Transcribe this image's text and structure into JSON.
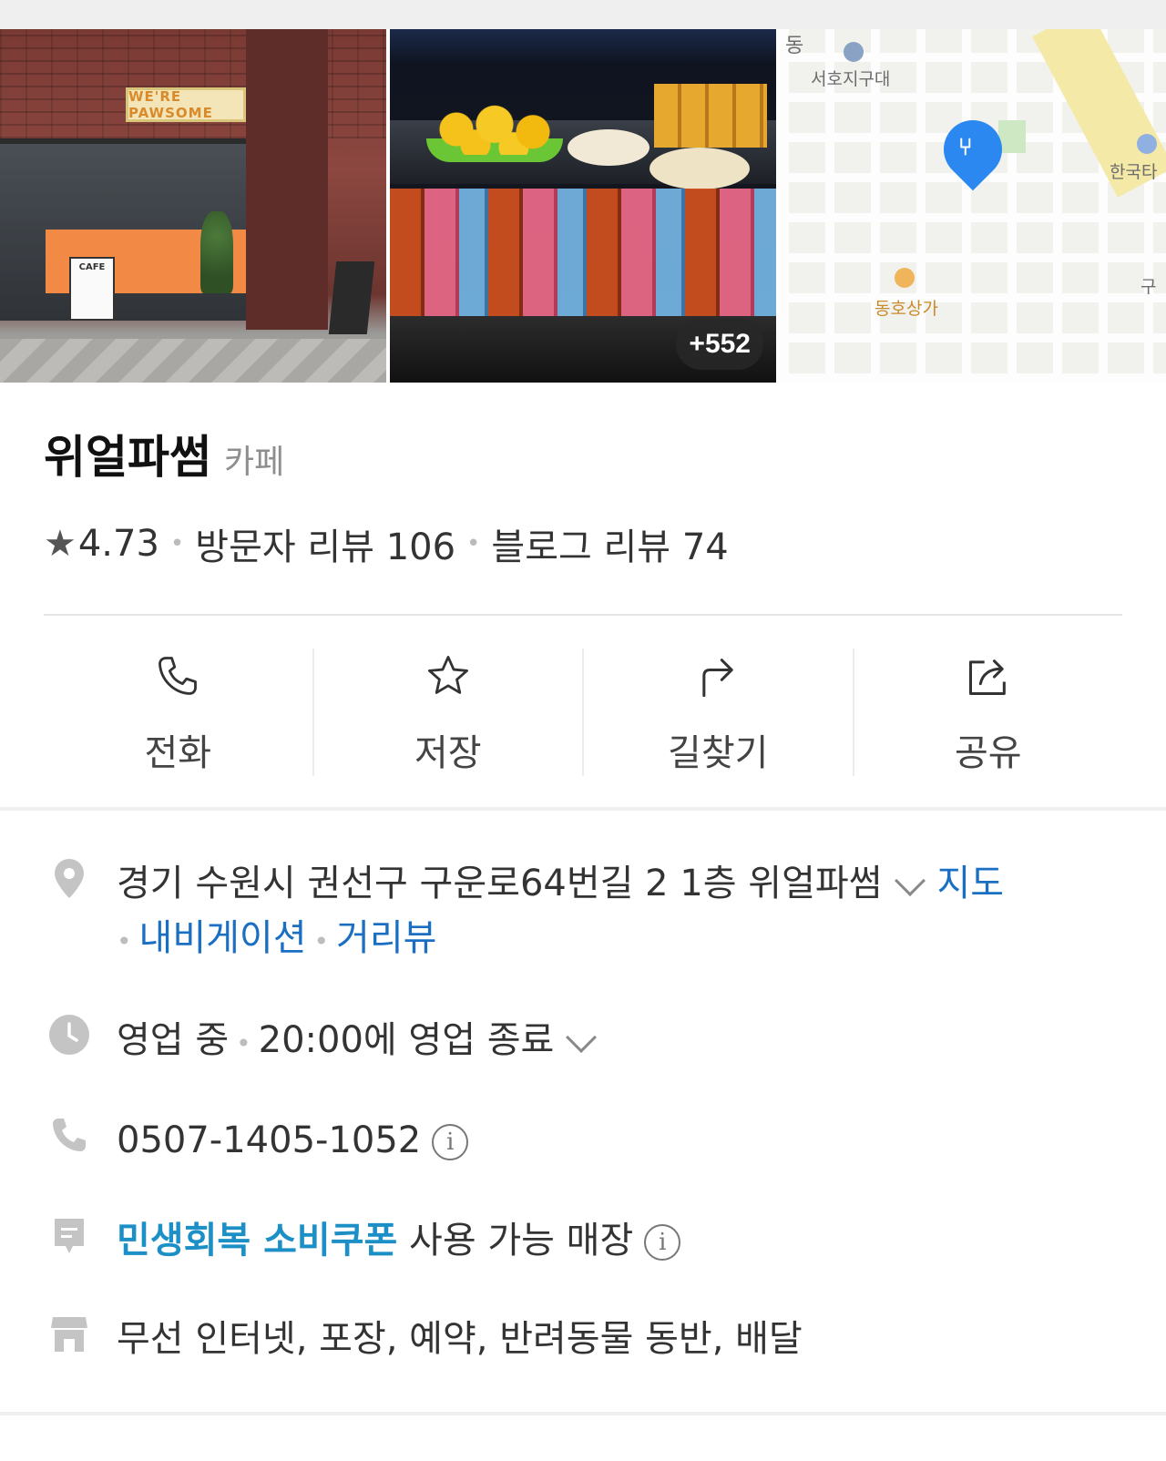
{
  "photos": {
    "storefront_sign": "WE'RE PAWSOME",
    "storefront_board": "CAFE",
    "more_count": "+552",
    "map": {
      "label_top": "동",
      "label_1": "서호지구대",
      "label_2": "한국타",
      "label_3": "동호상가",
      "label_4": "구"
    }
  },
  "place": {
    "name": "위얼파썸",
    "category": "카페",
    "rating": "4.73",
    "visitor_reviews": "방문자 리뷰 106",
    "blog_reviews": "블로그 리뷰 74"
  },
  "actions": [
    {
      "label": "전화",
      "icon": "phone-icon"
    },
    {
      "label": "저장",
      "icon": "star-icon"
    },
    {
      "label": "길찾기",
      "icon": "directions-icon"
    },
    {
      "label": "공유",
      "icon": "share-icon"
    }
  ],
  "info": {
    "address": "경기 수원시 권선구 구운로64번길 2 1층 위얼파썸",
    "address_links": {
      "map": "지도",
      "navigation": "내비게이션",
      "street_view": "거리뷰"
    },
    "hours_status": "영업 중",
    "hours_close": "20:00에 영업 종료",
    "phone": "0507-1405-1052",
    "coupon_highlight": "민생회복 소비쿠폰",
    "coupon_text": "사용 가능 매장",
    "amenities": "무선 인터넷, 포장, 예약, 반려동물 동반, 배달"
  },
  "colors": {
    "accent_blue": "#1a6fc2",
    "coupon_teal": "#1b8fc6",
    "map_pin": "#2b88f0"
  }
}
